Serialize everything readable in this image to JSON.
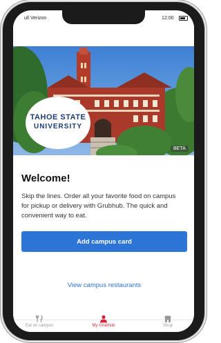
{
  "status_bar": {
    "carrier": "ull Verizon",
    "time": "12:00"
  },
  "hero": {
    "logo_line1": "TAHOE STATE",
    "logo_line2": "UNIVERSITY",
    "badge": "BETA"
  },
  "content": {
    "title": "Welcome!",
    "description": "Skip the lines. Order all your favorite food on campus for pickup or delivery with Grubhub. The quick and convenient way to eat.",
    "add_button": "Add campus card",
    "view_link": "View campus restaurants"
  },
  "tabbar": {
    "items": [
      {
        "label": "Eat on campus",
        "icon": "fork-knife-icon"
      },
      {
        "label": "My Grubhub",
        "icon": "person-icon"
      },
      {
        "label": "Shop",
        "icon": "store-icon"
      }
    ]
  },
  "colors": {
    "accent": "#2c74d6",
    "active_tab": "#d6243b"
  }
}
